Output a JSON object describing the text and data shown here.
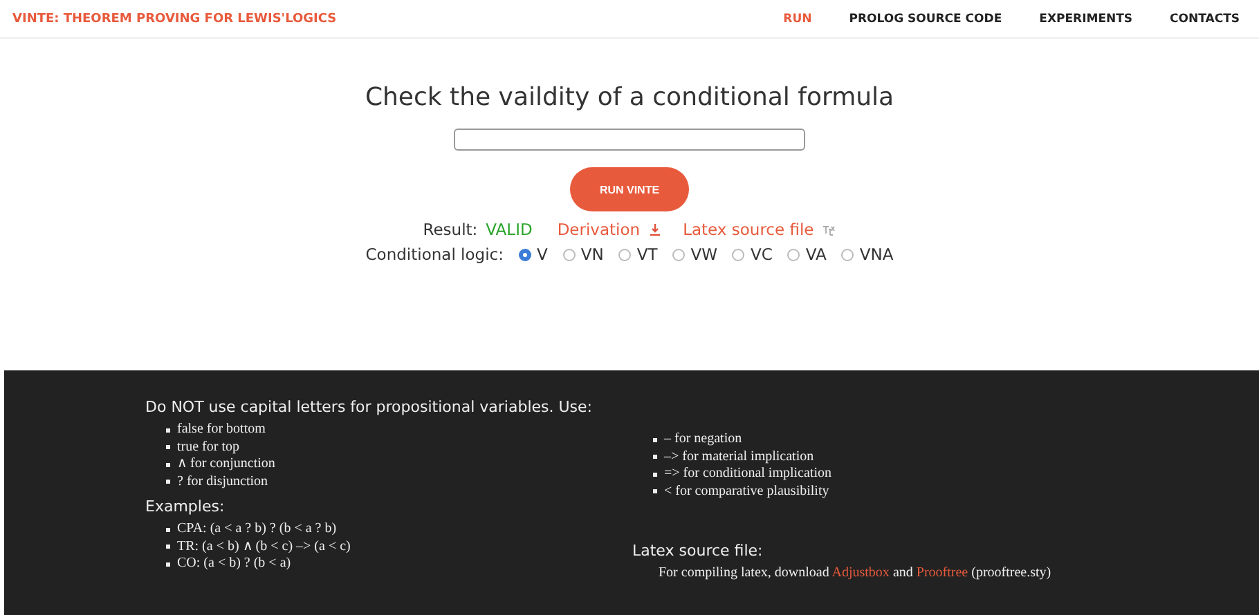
{
  "header": {
    "brand": "VINTE: THEOREM PROVING FOR LEWIS'LOGICS",
    "nav": [
      {
        "label": "RUN",
        "selected": true
      },
      {
        "label": "PROLOG SOURCE CODE",
        "selected": false
      },
      {
        "label": "EXPERIMENTS",
        "selected": false
      },
      {
        "label": "CONTACTS",
        "selected": false
      }
    ]
  },
  "form": {
    "title": "Check the vaildity of a conditional formula",
    "button": "RUN VINTE",
    "result": {
      "label": "Result:",
      "value": "VALID",
      "derivation": "Derivation",
      "latex": "Latex source file"
    },
    "logic_label": "Conditional logic:",
    "logics": [
      {
        "label": "V",
        "selected": true
      },
      {
        "label": "VN",
        "selected": false
      },
      {
        "label": "VT",
        "selected": false
      },
      {
        "label": "VW",
        "selected": false
      },
      {
        "label": "VC",
        "selected": false
      },
      {
        "label": "VA",
        "selected": false
      },
      {
        "label": "VNA",
        "selected": false
      }
    ]
  },
  "help": {
    "intro": "Do NOT use capital letters for propositional variables. Use:",
    "symbols_left": [
      "false for bottom",
      "true for top",
      "∧ for conjunction",
      "? for disjunction"
    ],
    "symbols_right": [
      "– for negation",
      "–> for material implication",
      "=> for conditional implication",
      "< for comparative plausibility"
    ],
    "examples_title": "Examples:",
    "examples": [
      "CPA: (a < a ? b) ? (b < a ? b)",
      "TR: (a < b) ∧ (b < c) –> (a < c)",
      "CO: (a < b) ? (b < a)"
    ],
    "latex_title": "Latex source file:",
    "latex_note": {
      "before": "For compiling latex, download ",
      "links": [
        "Adjustbox",
        "Prooftree"
      ],
      "between": " and ",
      "after": " (prooftree.sty)"
    }
  }
}
